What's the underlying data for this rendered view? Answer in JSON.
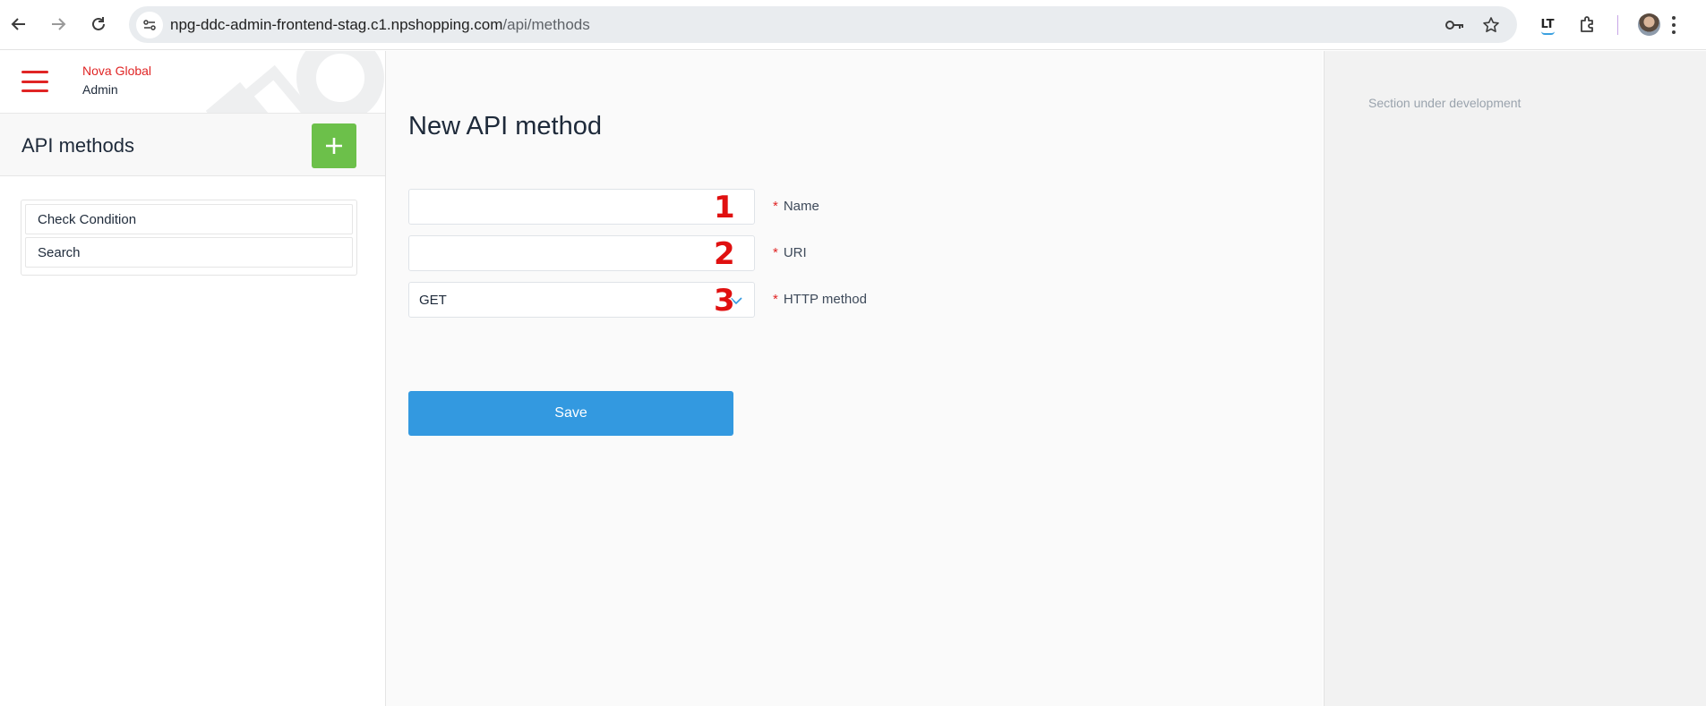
{
  "browser": {
    "url_host": "npg-ddc-admin-frontend-stag.c1.npshopping.com",
    "url_path": "/api/methods"
  },
  "brand": {
    "name": "Nova Global",
    "role": "Admin"
  },
  "sidebar": {
    "title": "API methods",
    "add_icon": "plus-icon",
    "items": [
      {
        "label": "Check Condition"
      },
      {
        "label": "Search"
      }
    ]
  },
  "form": {
    "title": "New API method",
    "fields": [
      {
        "marker": "1",
        "label": "Name",
        "value": ""
      },
      {
        "marker": "2",
        "label": "URI",
        "value": ""
      },
      {
        "marker": "3",
        "label": "HTTP method",
        "value": "GET"
      }
    ],
    "required_mark": "*",
    "save_label": "Save"
  },
  "right_panel": {
    "note": "Section under development"
  },
  "colors": {
    "brand_red": "#e02525",
    "add_green": "#6cc04a",
    "save_blue": "#3399e0",
    "marker_red": "#e01010"
  }
}
